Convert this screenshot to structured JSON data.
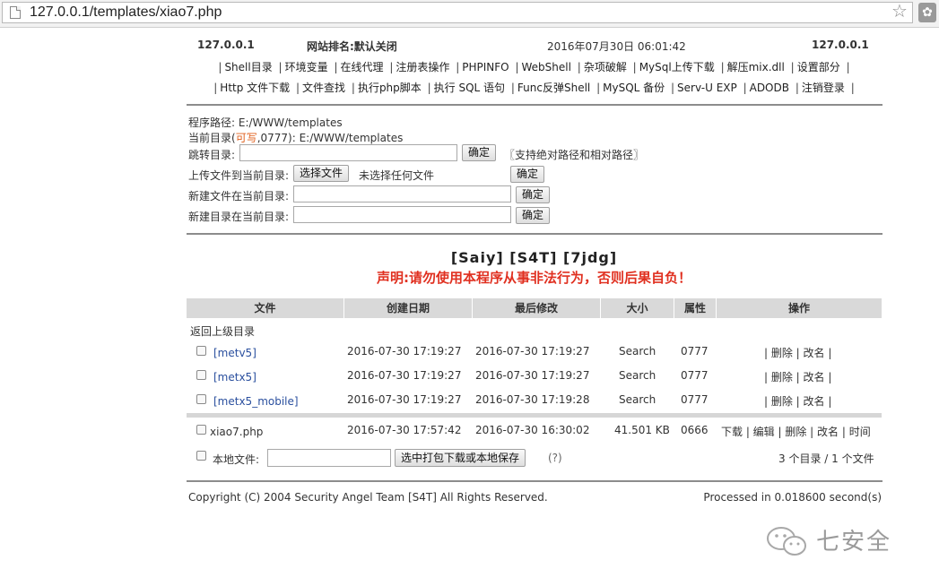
{
  "browser": {
    "url": "127.0.0.1/templates/xiao7.php"
  },
  "header": {
    "host_left": "127.0.0.1",
    "rank": "网站排名:默认关闭",
    "datetime": "2016年07月30日 06:01:42",
    "host_right": "127.0.0.1",
    "nav_row1": [
      "Shell目录",
      "环境变量",
      "在线代理",
      "注册表操作",
      "PHPINFO",
      "WebShell",
      "杂项破解",
      "MySql上传下载",
      "解压mix.dll",
      "设置部分"
    ],
    "nav_row2": [
      "Http 文件下载",
      "文件查找",
      "执行php脚本",
      "执行 SQL 语句",
      "Func反弹Shell",
      "MySQL 备份",
      "Serv-U EXP",
      "ADODB",
      "注销登录"
    ]
  },
  "paths": {
    "program_path_label": "程序路径: E:/WWW/templates",
    "current_dir_prefix": "当前目录(",
    "current_dir_writable": "可写",
    "current_dir_suffix": ",0777): E:/WWW/templates",
    "jump_label": "跳转目录:",
    "jump_confirm": "确定",
    "jump_hint": "〖支持绝对路径和相对路径〗",
    "upload_label": "上传文件到当前目录:",
    "choose_file": "选择文件",
    "no_file_chosen": "未选择任何文件",
    "upload_confirm": "确定",
    "newfile_label": "新建文件在当前目录:",
    "newfile_confirm": "确定",
    "newdir_label": "新建目录在当前目录:",
    "newdir_confirm": "确定"
  },
  "brand": "[Saiy] [S4T] [7jdg]",
  "warning": "声明:请勿使用本程序从事非法行为，否则后果自负！",
  "table": {
    "headers": [
      "文件",
      "创建日期",
      "最后修改",
      "大小",
      "属性",
      "操作"
    ],
    "parent_dir": "返回上级目录",
    "dirs": [
      {
        "name": "[metv5]",
        "created": "2016-07-30 17:19:27",
        "modified": "2016-07-30 17:19:27",
        "size": "Search",
        "perm": "0777",
        "actions": "| 删除 | 改名 |"
      },
      {
        "name": "[metx5]",
        "created": "2016-07-30 17:19:27",
        "modified": "2016-07-30 17:19:27",
        "size": "Search",
        "perm": "0777",
        "actions": "| 删除 | 改名 |"
      },
      {
        "name": "[metx5_mobile]",
        "created": "2016-07-30 17:19:27",
        "modified": "2016-07-30 17:19:28",
        "size": "Search",
        "perm": "0777",
        "actions": "| 删除 | 改名 |"
      }
    ],
    "files": [
      {
        "name": "xiao7.php",
        "created": "2016-07-30 17:57:42",
        "modified": "2016-07-30 16:30:02",
        "size": "41.501 KB",
        "perm": "0666",
        "actions": "下载 | 编辑 | 删除 | 改名 | 时间"
      }
    ],
    "local_file_label": "本地文件:",
    "pack_button": "选中打包下载或本地保存",
    "help": "(?)",
    "summary": "3 个目录 / 1 个文件"
  },
  "footer": {
    "copyright": "Copyright (C) 2004 Security Angel Team [S4T] All Rights Reserved.",
    "processed": "Processed in 0.018600 second(s)"
  },
  "watermark": "七安全"
}
